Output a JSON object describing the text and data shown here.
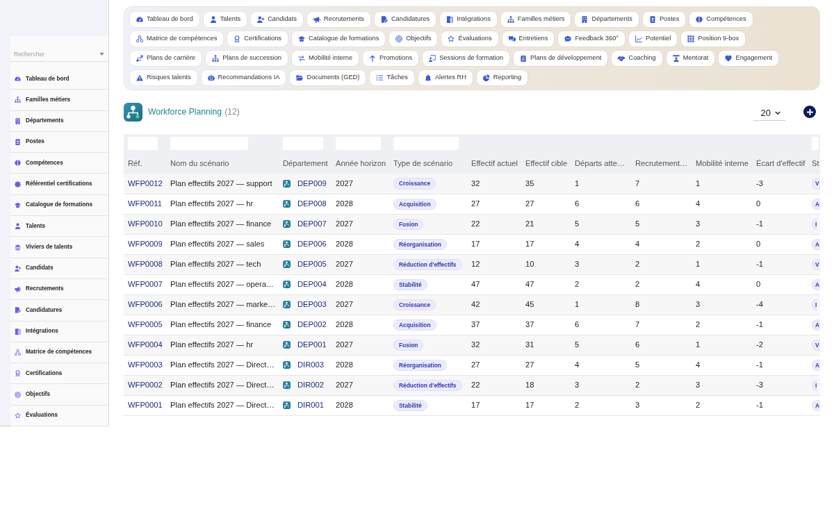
{
  "sidebar": {
    "search": {
      "placeholder": "Rechercher"
    },
    "items": [
      {
        "label": "Tableau de bord"
      },
      {
        "label": "Familles métiers"
      },
      {
        "label": "Départements"
      },
      {
        "label": "Postes"
      },
      {
        "label": "Compétences"
      },
      {
        "label": "Référentiel certifications"
      },
      {
        "label": "Catalogue de formations"
      },
      {
        "label": "Talents"
      },
      {
        "label": "Viviers de talents"
      },
      {
        "label": "Candidats"
      },
      {
        "label": "Recrutements"
      },
      {
        "label": "Candidatures"
      },
      {
        "label": "Intégrations"
      },
      {
        "label": "Matrice de compétences"
      },
      {
        "label": "Certifications"
      },
      {
        "label": "Objectifs"
      },
      {
        "label": "Évaluations"
      }
    ]
  },
  "module_nav": {
    "items": [
      {
        "label": "Tableau de bord"
      },
      {
        "label": "Talents"
      },
      {
        "label": "Candidats"
      },
      {
        "label": "Recrutements"
      },
      {
        "label": "Candidatures"
      },
      {
        "label": "Intégrations"
      },
      {
        "label": "Familles métiers"
      },
      {
        "label": "Départements"
      },
      {
        "label": "Postes"
      },
      {
        "label": "Compétences"
      },
      {
        "label": "Matrice de compétences"
      },
      {
        "label": "Certifications"
      },
      {
        "label": "Catalogue de formations"
      },
      {
        "label": "Objectifs"
      },
      {
        "label": "Évaluations"
      },
      {
        "label": "Entretiens"
      },
      {
        "label": "Feedback 360°"
      },
      {
        "label": "Potentiel"
      },
      {
        "label": "Position 9-box"
      },
      {
        "label": "Plans de carrière"
      },
      {
        "label": "Plans de succession"
      },
      {
        "label": "Mobilité interne"
      },
      {
        "label": "Promotions"
      },
      {
        "label": "Sessions de formation"
      },
      {
        "label": "Plans de développement"
      },
      {
        "label": "Coaching"
      },
      {
        "label": "Mentorat"
      },
      {
        "label": "Engagement"
      },
      {
        "label": "Risques talents"
      },
      {
        "label": "Recommandations IA"
      },
      {
        "label": "Documents (GED)"
      },
      {
        "label": "Tâches"
      },
      {
        "label": "Alertes RH"
      },
      {
        "label": "Reporting"
      }
    ]
  },
  "header": {
    "title": "Workforce Planning",
    "count": "(12)",
    "page_size": "20"
  },
  "table": {
    "columns": [
      {
        "label": "Réf.",
        "kind": "link",
        "filter": true
      },
      {
        "label": "Nom du scénario",
        "kind": "text",
        "filter": true
      },
      {
        "label": "Département",
        "kind": "department",
        "filter": true
      },
      {
        "label": "Année horizon",
        "kind": "text",
        "filter": true
      },
      {
        "label": "Type de scénario",
        "kind": "tag",
        "filter": true
      },
      {
        "label": "Effectif actuel",
        "kind": "text",
        "filter": false
      },
      {
        "label": "Effectif cible",
        "kind": "text",
        "filter": false
      },
      {
        "label": "Départs atte…",
        "kind": "text",
        "filter": false
      },
      {
        "label": "Recrutement…",
        "kind": "text",
        "filter": false
      },
      {
        "label": "Mobilité interne",
        "kind": "text",
        "filter": false
      },
      {
        "label": "Écart d'effectif",
        "kind": "text",
        "filter": false
      },
      {
        "label": "St",
        "kind": "tag",
        "filter": true
      }
    ],
    "rows": [
      {
        "cells": [
          "WFP0012",
          "Plan effectifs 2027 — support",
          "DEP009",
          "2027",
          "Croissance",
          "32",
          "35",
          "1",
          "7",
          "1",
          "-3",
          "V"
        ]
      },
      {
        "cells": [
          "WFP0011",
          "Plan effectifs 2027 — hr",
          "DEP008",
          "2028",
          "Acquisition",
          "27",
          "27",
          "6",
          "6",
          "4",
          "0",
          "A"
        ]
      },
      {
        "cells": [
          "WFP0010",
          "Plan effectifs 2027 — finance",
          "DEP007",
          "2027",
          "Fusion",
          "22",
          "21",
          "5",
          "5",
          "3",
          "-1",
          "I"
        ]
      },
      {
        "cells": [
          "WFP0009",
          "Plan effectifs 2027 — sales",
          "DEP006",
          "2028",
          "Réorganisation",
          "17",
          "17",
          "4",
          "4",
          "2",
          "0",
          "A"
        ]
      },
      {
        "cells": [
          "WFP0008",
          "Plan effectifs 2027 — tech",
          "DEP005",
          "2027",
          "Réduction d'effectifs",
          "12",
          "10",
          "3",
          "2",
          "1",
          "-1",
          "V"
        ]
      },
      {
        "cells": [
          "WFP0007",
          "Plan effectifs 2027 — opera…",
          "DEP004",
          "2028",
          "Stabilité",
          "47",
          "47",
          "2",
          "2",
          "4",
          "0",
          "A"
        ]
      },
      {
        "cells": [
          "WFP0006",
          "Plan effectifs 2027 — marke…",
          "DEP003",
          "2027",
          "Croissance",
          "42",
          "45",
          "1",
          "8",
          "3",
          "-4",
          "I"
        ]
      },
      {
        "cells": [
          "WFP0005",
          "Plan effectifs 2027 — finance",
          "DEP002",
          "2028",
          "Acquisition",
          "37",
          "37",
          "6",
          "7",
          "2",
          "-1",
          "A"
        ]
      },
      {
        "cells": [
          "WFP0004",
          "Plan effectifs 2027 — hr",
          "DEP001",
          "2027",
          "Fusion",
          "32",
          "31",
          "5",
          "6",
          "1",
          "-2",
          "V"
        ]
      },
      {
        "cells": [
          "WFP0003",
          "Plan effectifs 2027 — Direct…",
          "DIR003",
          "2028",
          "Réorganisation",
          "27",
          "27",
          "4",
          "5",
          "4",
          "-1",
          "A"
        ]
      },
      {
        "cells": [
          "WFP0002",
          "Plan effectifs 2027 — Direct…",
          "DIR002",
          "2027",
          "Réduction d'effectifs",
          "22",
          "18",
          "3",
          "2",
          "3",
          "-3",
          "I"
        ]
      },
      {
        "cells": [
          "WFP0001",
          "Plan effectifs 2027 — Direct…",
          "DIR001",
          "2028",
          "Stabilité",
          "17",
          "17",
          "2",
          "3",
          "2",
          "-1",
          "A"
        ]
      }
    ]
  }
}
